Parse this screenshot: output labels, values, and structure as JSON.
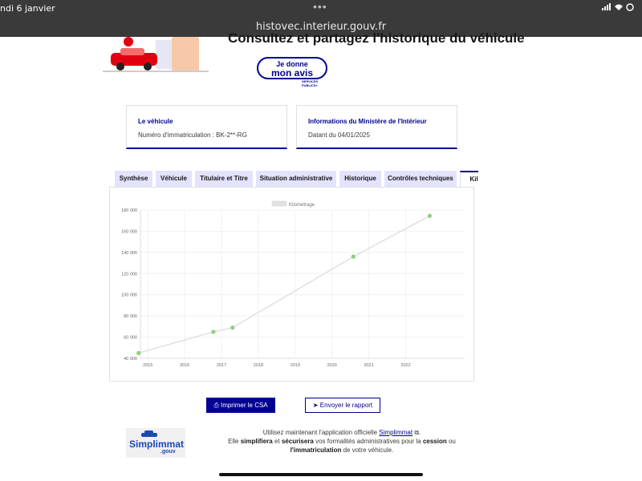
{
  "status_bar": {
    "time": "ndi 6 janvier",
    "url": "histovec.interieur.gouv.fr",
    "battery_icon": "battery-icon"
  },
  "header": {
    "title": "Consultez et partagez l'historique du véhicule",
    "avis_line1": "Je donne",
    "avis_line2": "mon avis",
    "services_publics_line1": "SERVICES",
    "services_publics_line2": "PUBLICS+"
  },
  "cards": {
    "vehicle": {
      "title": "Le véhicule",
      "text": "Numéro d'immatriculation : BK-2**-RG"
    },
    "ministry": {
      "title": "Informations du Ministère de l'Intérieur",
      "text": "Datant du 04/01/2025"
    }
  },
  "tabs": [
    {
      "label": "Synthèse"
    },
    {
      "label": "Véhicule"
    },
    {
      "label": "Titulaire et Titre"
    },
    {
      "label": "Situation administrative"
    },
    {
      "label": "Historique"
    },
    {
      "label": "Contrôles techniques"
    },
    {
      "label": "Kilo"
    }
  ],
  "chart_data": {
    "type": "line",
    "legend": "Kilométrage",
    "legend_position": "top-center",
    "grid": true,
    "color": "#8fce7f",
    "line_color": "#dcdcdc",
    "x_ticks": [
      "2015",
      "2016",
      "2017",
      "2018",
      "2019",
      "2020",
      "2021",
      "2022"
    ],
    "y_ticks": [
      "40 000",
      "60 000",
      "80 000",
      "100 000",
      "120 000",
      "140 000",
      "160 000",
      "180 000"
    ],
    "xlim": [
      2014.8,
      2023.6
    ],
    "ylim": [
      40000,
      180000
    ],
    "series": [
      {
        "name": "Kilométrage",
        "points": [
          {
            "x": 2014.75,
            "y": 45000
          },
          {
            "x": 2016.78,
            "y": 65000
          },
          {
            "x": 2017.3,
            "y": 69000
          },
          {
            "x": 2020.58,
            "y": 136000
          },
          {
            "x": 2022.65,
            "y": 174500
          }
        ]
      }
    ]
  },
  "actions": {
    "print_label": "Imprimer le CSA",
    "send_label": "Envoyer le rapport"
  },
  "footer": {
    "logo_main": "Simplimmat",
    "logo_sub": ".gouv",
    "line1_pre": "Utilisez maintenant l'application officielle",
    "line1_link": "Simplimmat",
    "line2_a": "Elle",
    "line2_b": "simplifiera",
    "line2_c": "et",
    "line2_d": "sécurisera",
    "line2_e": "vos formalités administratives pour la",
    "line2_f": "cession",
    "line2_g": "ou",
    "line3_a": "l'immatriculation",
    "line3_b": "de votre véhicule."
  }
}
